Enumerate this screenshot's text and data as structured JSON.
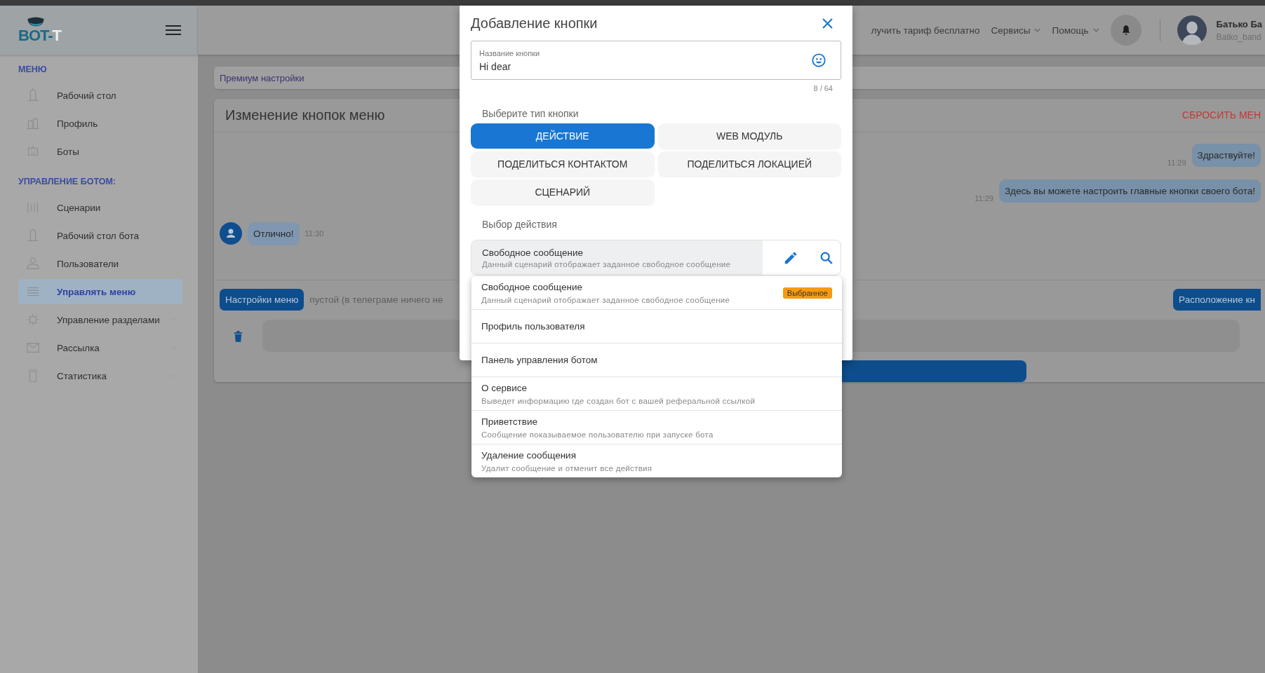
{
  "logo": {
    "text": "BOT-",
    "suffix": "T"
  },
  "sidebar": {
    "sections": [
      {
        "label": "МЕНЮ",
        "items": [
          {
            "label": "Рабочий стол",
            "kind": "link",
            "selected": false
          },
          {
            "label": "Профиль",
            "kind": "link",
            "selected": false
          },
          {
            "label": "Боты",
            "kind": "link",
            "selected": false
          }
        ]
      },
      {
        "label": "УПРАВЛЕНИЕ БОТОМ:",
        "items": [
          {
            "label": "Сценарии",
            "kind": "link",
            "selected": false
          },
          {
            "label": "Рабочий стол бота",
            "kind": "link",
            "selected": false
          },
          {
            "label": "Пользователи",
            "kind": "link",
            "selected": false
          },
          {
            "label": "Управлять меню",
            "kind": "link",
            "selected": true
          },
          {
            "label": "Управление разделами",
            "kind": "group",
            "selected": false
          },
          {
            "label": "Рассылка",
            "kind": "group",
            "selected": false
          },
          {
            "label": "Статистика",
            "kind": "group",
            "selected": false
          }
        ]
      }
    ]
  },
  "header": {
    "links": [
      {
        "label": "лучить тариф бесплатно",
        "kind": "link"
      },
      {
        "label": "Сервисы",
        "kind": "menu"
      },
      {
        "label": "Помощь",
        "kind": "menu"
      }
    ],
    "user": {
      "name": "Батько Ба",
      "login": "Batko_band"
    }
  },
  "breadcrumb": "Премиум настройки",
  "card": {
    "title": "Изменение кнопок меню",
    "reset": "СБРОСИТЬ МЕН",
    "messages": [
      {
        "kind": "outgoing",
        "text": "Здраствуйте!",
        "time": "11:29"
      },
      {
        "kind": "outgoing",
        "text": "Здесь вы можете настроить главные кнопки своего бота!",
        "time": "11:29"
      },
      {
        "kind": "incoming",
        "text": "Отлично!",
        "time": "11:30"
      }
    ],
    "menu_settings": "Настройки меню",
    "empty_note": "пустой (в телеграме ничего не",
    "layout_button": "Расположение кн"
  },
  "dialog": {
    "title": "Добавление кнопки",
    "name_field": {
      "label": "Название кнопки",
      "value": "Hi dear",
      "counter": "8 / 64"
    },
    "type_label": "Выберите тип кнопки",
    "types": [
      {
        "label": "ДЕЙСТВИЕ",
        "selected": true
      },
      {
        "label": "WEB МОДУЛЬ",
        "selected": false
      },
      {
        "label": "ПОДЕЛИТЬСЯ КОНТАКТОМ",
        "selected": false
      },
      {
        "label": "ПОДЕЛИТЬСЯ ЛОКАЦИЕЙ",
        "selected": false
      },
      {
        "label": "СЦЕНАРИЙ",
        "selected": false
      }
    ],
    "action_label": "Выбор действия",
    "action": {
      "title": "Свободное сообщение",
      "description": "Данный сценарий отображает заданное свободное сообщение"
    },
    "options": [
      {
        "title": "Свободное сообщение",
        "description": "Данный сценарий отображает заданное свободное сообщение",
        "badge": "Выбранное"
      },
      {
        "title": "Профиль пользователя"
      },
      {
        "title": "Панель управления ботом"
      },
      {
        "title": "О сервисе",
        "description": "Выведет информацию где создан бот с вашей реферальной ссылкой"
      },
      {
        "title": "Приветствие",
        "description": "Сообщение показываемое пользователю при запуске бота"
      },
      {
        "title": "Удаление сообщения",
        "description": "Удалит сообщение и отменит все действия"
      }
    ]
  }
}
